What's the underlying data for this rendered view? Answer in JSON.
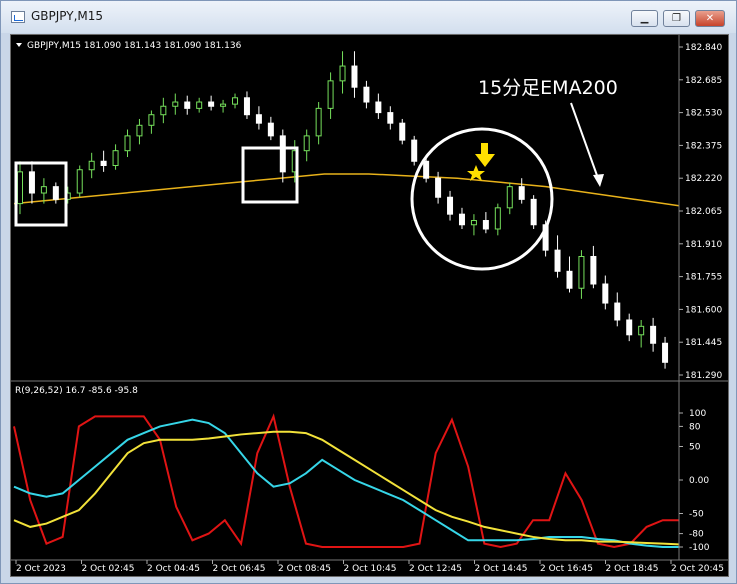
{
  "window": {
    "title": "GBPJPY,M15",
    "minimize_glyph": "▁",
    "restore_glyph": "❐",
    "close_glyph": "✕"
  },
  "chart_info": "GBPJPY,M15  181.090 181.143 181.090 181.136",
  "annotation_text": "15分足EMA200",
  "colors": {
    "bull": "#76e05c",
    "bear": "#ffffff",
    "ema": "#e8b21a",
    "osc_red": "#e01414",
    "osc_cyan": "#36d6e8",
    "osc_yellow": "#f2e23a",
    "grid": "#4a4a4a",
    "text": "#ffffff",
    "arrow": "#ffe000"
  },
  "icons": [
    "expand-triangle-icon",
    "down-arrow-icon",
    "star-icon"
  ],
  "chart_data": [
    {
      "type": "candlestick",
      "title": "GBPJPY,M15",
      "price_ticks": [
        "182.840",
        "182.685",
        "182.530",
        "182.375",
        "182.220",
        "182.065",
        "181.910",
        "181.755",
        "181.600",
        "181.445",
        "181.290"
      ],
      "ylim": [
        181.29,
        182.84
      ],
      "candles": [
        [
          182.1,
          182.3,
          182.05,
          182.25
        ],
        [
          182.25,
          182.3,
          182.1,
          182.15
        ],
        [
          182.15,
          182.22,
          182.1,
          182.18
        ],
        [
          182.18,
          182.2,
          182.1,
          182.12
        ],
        [
          182.12,
          182.18,
          182.1,
          182.15
        ],
        [
          182.15,
          182.28,
          182.13,
          182.26
        ],
        [
          182.26,
          182.34,
          182.22,
          182.3
        ],
        [
          182.3,
          182.35,
          182.25,
          182.28
        ],
        [
          182.28,
          182.38,
          182.26,
          182.35
        ],
        [
          182.35,
          182.45,
          182.32,
          182.42
        ],
        [
          182.42,
          182.5,
          182.38,
          182.47
        ],
        [
          182.47,
          182.54,
          182.43,
          182.52
        ],
        [
          182.52,
          182.6,
          182.48,
          182.56
        ],
        [
          182.56,
          182.62,
          182.52,
          182.58
        ],
        [
          182.58,
          182.61,
          182.52,
          182.55
        ],
        [
          182.55,
          182.6,
          182.53,
          182.58
        ],
        [
          182.58,
          182.61,
          182.54,
          182.56
        ],
        [
          182.56,
          182.59,
          182.53,
          182.57
        ],
        [
          182.57,
          182.62,
          182.55,
          182.6
        ],
        [
          182.6,
          182.63,
          182.5,
          182.52
        ],
        [
          182.52,
          182.56,
          182.45,
          182.48
        ],
        [
          182.48,
          182.51,
          182.4,
          182.42
        ],
        [
          182.42,
          182.45,
          182.2,
          182.25
        ],
        [
          182.25,
          182.4,
          182.2,
          182.35
        ],
        [
          182.35,
          182.45,
          182.3,
          182.42
        ],
        [
          182.42,
          182.58,
          182.38,
          182.55
        ],
        [
          182.55,
          182.72,
          182.5,
          182.68
        ],
        [
          182.68,
          182.82,
          182.62,
          182.75
        ],
        [
          182.75,
          182.82,
          182.6,
          182.65
        ],
        [
          182.65,
          182.68,
          182.55,
          182.58
        ],
        [
          182.58,
          182.62,
          182.5,
          182.53
        ],
        [
          182.53,
          182.56,
          182.45,
          182.48
        ],
        [
          182.48,
          182.5,
          182.38,
          182.4
        ],
        [
          182.4,
          182.42,
          182.28,
          182.3
        ],
        [
          182.3,
          182.33,
          182.2,
          182.22
        ],
        [
          182.22,
          182.25,
          182.1,
          182.13
        ],
        [
          182.13,
          182.16,
          182.02,
          182.05
        ],
        [
          182.05,
          182.08,
          181.98,
          182.0
        ],
        [
          182.0,
          182.05,
          181.95,
          182.02
        ],
        [
          182.02,
          182.06,
          181.96,
          181.98
        ],
        [
          181.98,
          182.1,
          181.95,
          182.08
        ],
        [
          182.08,
          182.2,
          182.05,
          182.18
        ],
        [
          182.18,
          182.22,
          182.1,
          182.12
        ],
        [
          182.12,
          182.14,
          181.98,
          182.0
        ],
        [
          182.0,
          182.02,
          181.85,
          181.88
        ],
        [
          181.88,
          181.95,
          181.75,
          181.78
        ],
        [
          181.78,
          181.85,
          181.68,
          181.7
        ],
        [
          181.7,
          181.88,
          181.65,
          181.85
        ],
        [
          181.85,
          181.9,
          181.7,
          181.72
        ],
        [
          181.72,
          181.76,
          181.6,
          181.63
        ],
        [
          181.63,
          181.68,
          181.52,
          181.55
        ],
        [
          181.55,
          181.58,
          181.45,
          181.48
        ],
        [
          181.48,
          181.55,
          181.42,
          181.52
        ],
        [
          181.52,
          181.56,
          181.4,
          181.44
        ],
        [
          181.44,
          181.47,
          181.32,
          181.35
        ]
      ],
      "ema200": [
        182.1,
        182.12,
        182.14,
        182.16,
        182.18,
        182.2,
        182.22,
        182.24,
        182.24,
        182.23,
        182.22,
        182.2,
        182.18,
        182.15,
        182.12,
        182.09
      ],
      "time_labels": [
        "2 Oct 2023",
        "2 Oct 02:45",
        "2 Oct 04:45",
        "2 Oct 06:45",
        "2 Oct 08:45",
        "2 Oct 10:45",
        "2 Oct 12:45",
        "2 Oct 14:45",
        "2 Oct 16:45",
        "2 Oct 18:45",
        "2 Oct 20:45"
      ]
    },
    {
      "type": "line",
      "title": "R(9,26,52) 16.7 -85.6 -95.8",
      "y_ticks": [
        "100",
        "80",
        "50",
        "0.00",
        "-50",
        "-80",
        "-100"
      ],
      "ylim": [
        -100,
        100
      ],
      "series": [
        {
          "color": "#e01414",
          "values": [
            80,
            -30,
            -95,
            -85,
            80,
            95,
            95,
            95,
            95,
            60,
            -40,
            -90,
            -80,
            -60,
            -95,
            40,
            95,
            -10,
            -95,
            -100,
            -100,
            -100,
            -100,
            -100,
            -100,
            -95,
            40,
            90,
            20,
            -95,
            -100,
            -95,
            -60,
            -60,
            10,
            -30,
            -95,
            -100,
            -95,
            -70,
            -60,
            -60
          ]
        },
        {
          "color": "#36d6e8",
          "values": [
            -10,
            -20,
            -25,
            -20,
            0,
            20,
            40,
            60,
            70,
            80,
            85,
            90,
            85,
            70,
            40,
            10,
            -10,
            -5,
            10,
            30,
            15,
            0,
            -10,
            -20,
            -30,
            -45,
            -60,
            -75,
            -90,
            -90,
            -90,
            -90,
            -88,
            -85,
            -85,
            -85,
            -88,
            -90,
            -95,
            -98,
            -100,
            -100
          ]
        },
        {
          "color": "#f2e23a",
          "values": [
            -60,
            -70,
            -65,
            -55,
            -45,
            -20,
            10,
            40,
            55,
            60,
            60,
            60,
            62,
            65,
            68,
            70,
            72,
            72,
            70,
            60,
            45,
            30,
            15,
            0,
            -15,
            -30,
            -45,
            -55,
            -62,
            -70,
            -75,
            -80,
            -85,
            -88,
            -90,
            -90,
            -92,
            -92,
            -93,
            -94,
            -95,
            -96
          ]
        }
      ]
    }
  ]
}
